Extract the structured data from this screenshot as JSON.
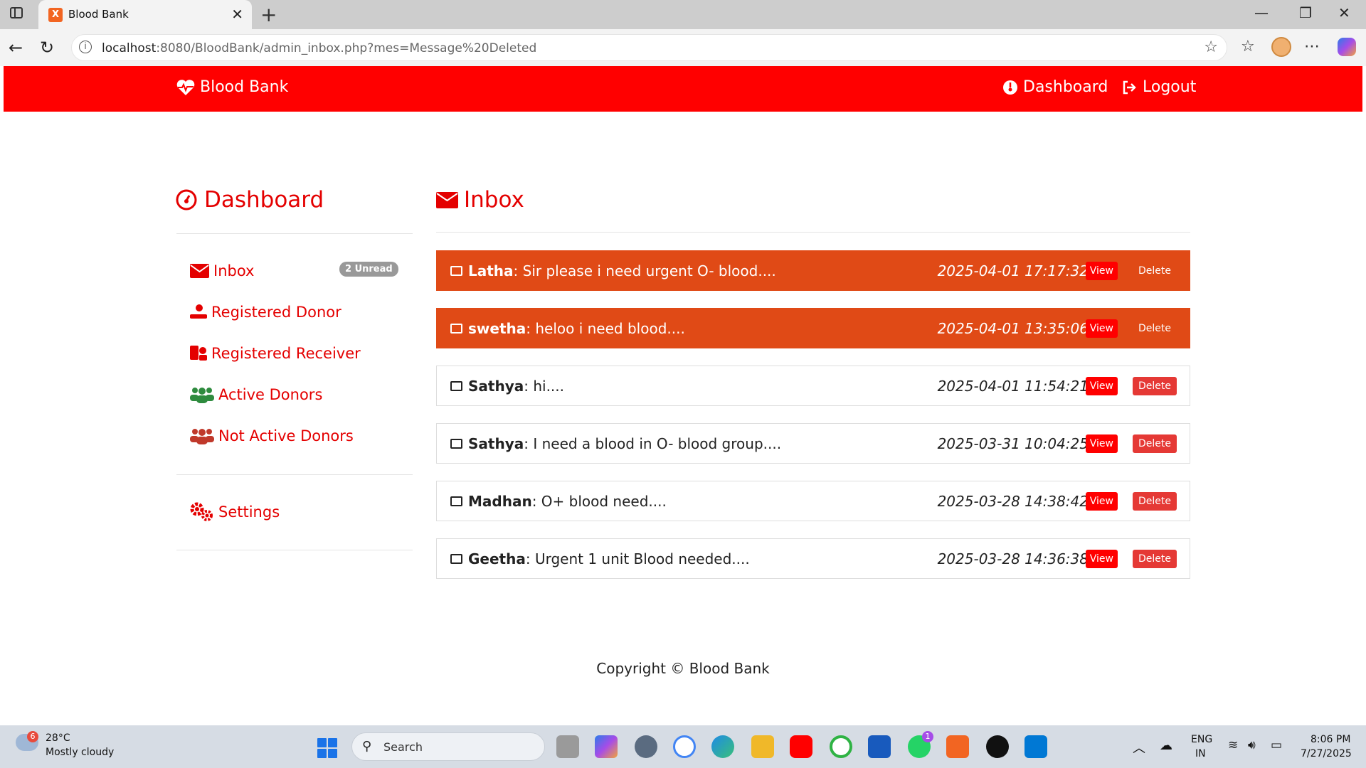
{
  "browser": {
    "tab_title": "Blood Bank",
    "tab_favicon": "X",
    "url_host": "localhost",
    "url_rest": ":8080/BloodBank/admin_inbox.php?mes=Message%20Deleted"
  },
  "navbar": {
    "brand": "Blood Bank",
    "dashboard": "Dashboard",
    "logout": "Logout"
  },
  "sidebar": {
    "title": "Dashboard",
    "items": [
      {
        "label": "Inbox",
        "icon": "envelope-icon"
      },
      {
        "label": "Registered Donor",
        "icon": "donor-icon"
      },
      {
        "label": "Registered Receiver",
        "icon": "receiver-icon"
      },
      {
        "label": "Active Donors",
        "icon": "users-icon"
      },
      {
        "label": "Not Active Donors",
        "icon": "users-icon"
      }
    ],
    "unread_badge": "2 Unread",
    "settings": "Settings"
  },
  "inbox": {
    "title": "Inbox",
    "view_label": "View",
    "delete_label": "Delete",
    "messages": [
      {
        "sender": "Latha",
        "text": ": Sir please i need urgent O- blood....",
        "date": "2025-04-01 17:17:32",
        "unread": true
      },
      {
        "sender": "swetha",
        "text": ": heloo i need blood....",
        "date": "2025-04-01 13:35:06",
        "unread": true
      },
      {
        "sender": "Sathya",
        "text": ": hi....",
        "date": "2025-04-01 11:54:21",
        "unread": false
      },
      {
        "sender": "Sathya",
        "text": ": I need a blood in O- blood group....",
        "date": "2025-03-31 10:04:25",
        "unread": false
      },
      {
        "sender": "Madhan",
        "text": ": O+ blood need....",
        "date": "2025-03-28 14:38:42",
        "unread": false
      },
      {
        "sender": "Geetha",
        "text": ": Urgent 1 unit Blood needed....",
        "date": "2025-03-28 14:36:38",
        "unread": false
      }
    ]
  },
  "footer": "Copyright © Blood Bank",
  "taskbar": {
    "weather_temp": "28°C",
    "weather_desc": "Mostly cloudy",
    "weather_badge": "6",
    "search": "Search",
    "lang": "ENG",
    "region": "IN",
    "time": "8:06 PM",
    "date": "7/27/2025",
    "whatsapp_badge": "1"
  },
  "colors": {
    "brand_red": "#ff0000",
    "unread_orange": "#e04a16",
    "delete_red": "#e53935",
    "active_green": "#2e8b3e",
    "inactive_brown": "#c0392b"
  }
}
